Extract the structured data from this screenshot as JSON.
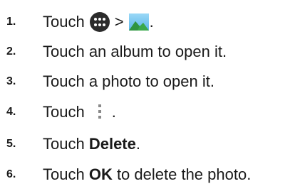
{
  "steps": [
    {
      "number": "1.",
      "prefix": "Touch",
      "separator": ">",
      "suffix": ".",
      "icons": [
        "apps-icon",
        "gallery-icon"
      ]
    },
    {
      "number": "2.",
      "text": "Touch an album to open it."
    },
    {
      "number": "3.",
      "text": "Touch a photo to open it."
    },
    {
      "number": "4.",
      "prefix": "Touch",
      "suffix": ".",
      "icons": [
        "more-options-icon"
      ]
    },
    {
      "number": "5.",
      "prefix": "Touch ",
      "bold": "Delete",
      "suffix": "."
    },
    {
      "number": "6.",
      "prefix": "Touch ",
      "bold": "OK",
      "suffix": " to delete the photo."
    }
  ],
  "colors": {
    "text": "#1a1a1a",
    "apps_icon_bg": "#2b2b2b",
    "gallery_sky": "#7ec8f0",
    "gallery_mountain": "#3aa84a"
  }
}
